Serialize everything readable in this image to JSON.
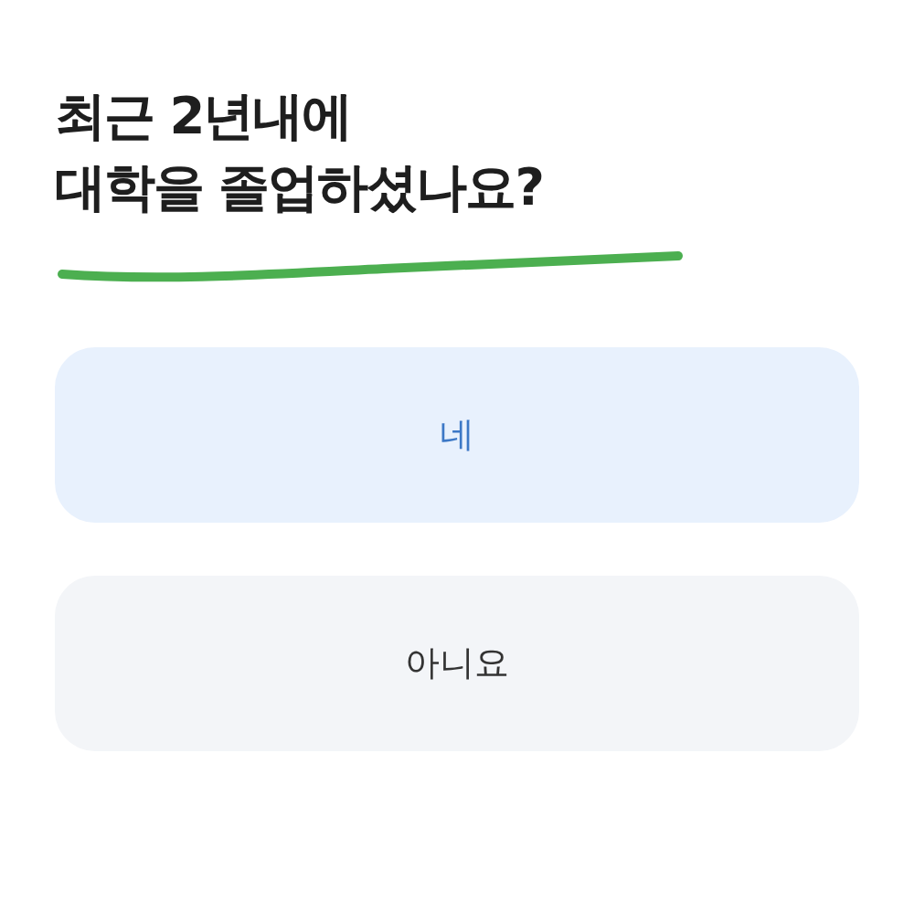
{
  "question": {
    "lines": [
      "최근 2년내에",
      "대학을 졸업하셨나요?"
    ]
  },
  "options": [
    {
      "label": "네",
      "selected": true
    },
    {
      "label": "아니요",
      "selected": false
    }
  ]
}
